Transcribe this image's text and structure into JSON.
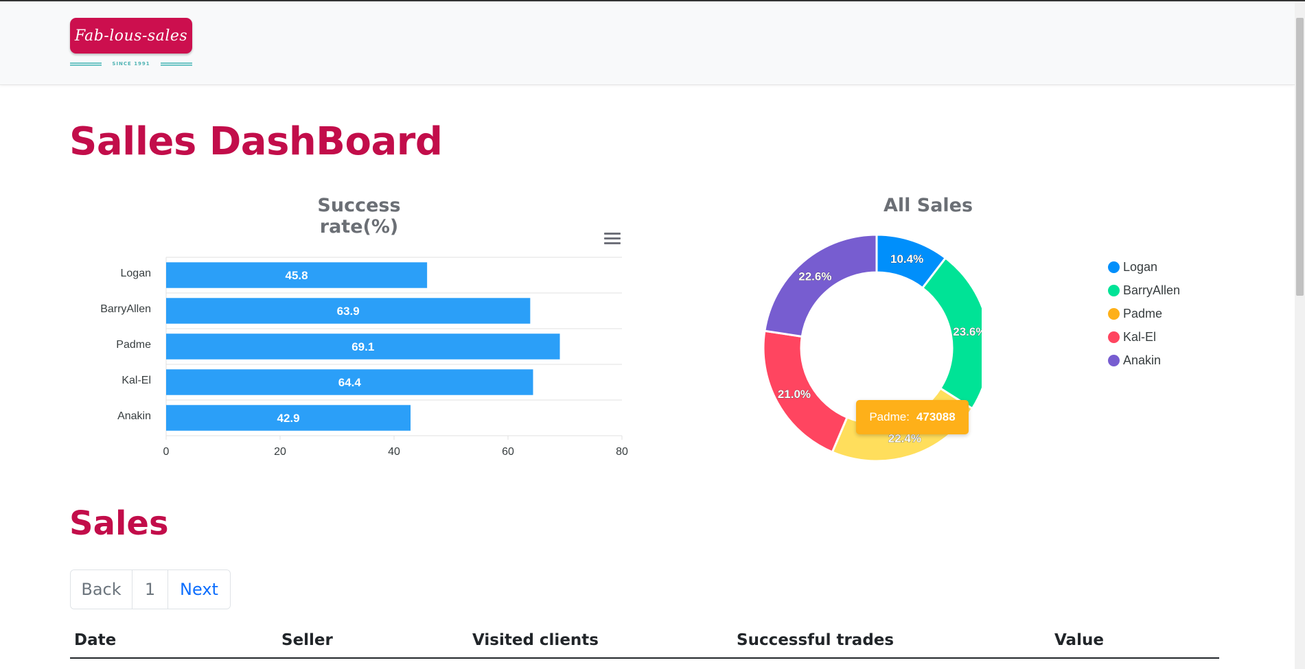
{
  "header": {
    "logo_text": "Fab-lous-sales",
    "logo_since": "SINCE 1991"
  },
  "page_title": "Salles DashBoard",
  "success_chart": {
    "title": "Success rate(%)"
  },
  "sales_chart": {
    "title": "All Sales",
    "tooltip_label": "Padme:",
    "tooltip_value": "473088"
  },
  "chart_data": [
    {
      "type": "bar",
      "orientation": "horizontal",
      "title": "Success rate(%)",
      "categories": [
        "Logan",
        "BarryAllen",
        "Padme",
        "Kal-El",
        "Anakin"
      ],
      "values": [
        45.8,
        63.9,
        69.1,
        64.4,
        42.9
      ],
      "xlim": [
        0,
        80
      ],
      "xticks": [
        0,
        20,
        40,
        60,
        80
      ],
      "color": "#2b9ff8",
      "grid": true
    },
    {
      "type": "pie",
      "variant": "donut",
      "title": "All Sales",
      "labels": [
        "Logan",
        "BarryAllen",
        "Padme",
        "Kal-El",
        "Anakin"
      ],
      "values": [
        10.4,
        23.6,
        22.4,
        21.0,
        22.6
      ],
      "value_labels": [
        "10.4%",
        "23.6%",
        "22.4%",
        "21.0%",
        "22.6%"
      ],
      "colors": [
        "#008ffb",
        "#00e396",
        "#feb019",
        "#ff4560",
        "#775dd0"
      ],
      "slice_colors": [
        "#008ffb",
        "#00e396",
        "#ffde5c",
        "#ff4560",
        "#775dd0"
      ],
      "legend_position": "right"
    }
  ],
  "sales_section": {
    "title": "Sales",
    "pagination": {
      "back": "Back",
      "page": "1",
      "next": "Next"
    },
    "columns": [
      "Date",
      "Seller",
      "Visited clients",
      "Successful trades",
      "Value"
    ]
  }
}
